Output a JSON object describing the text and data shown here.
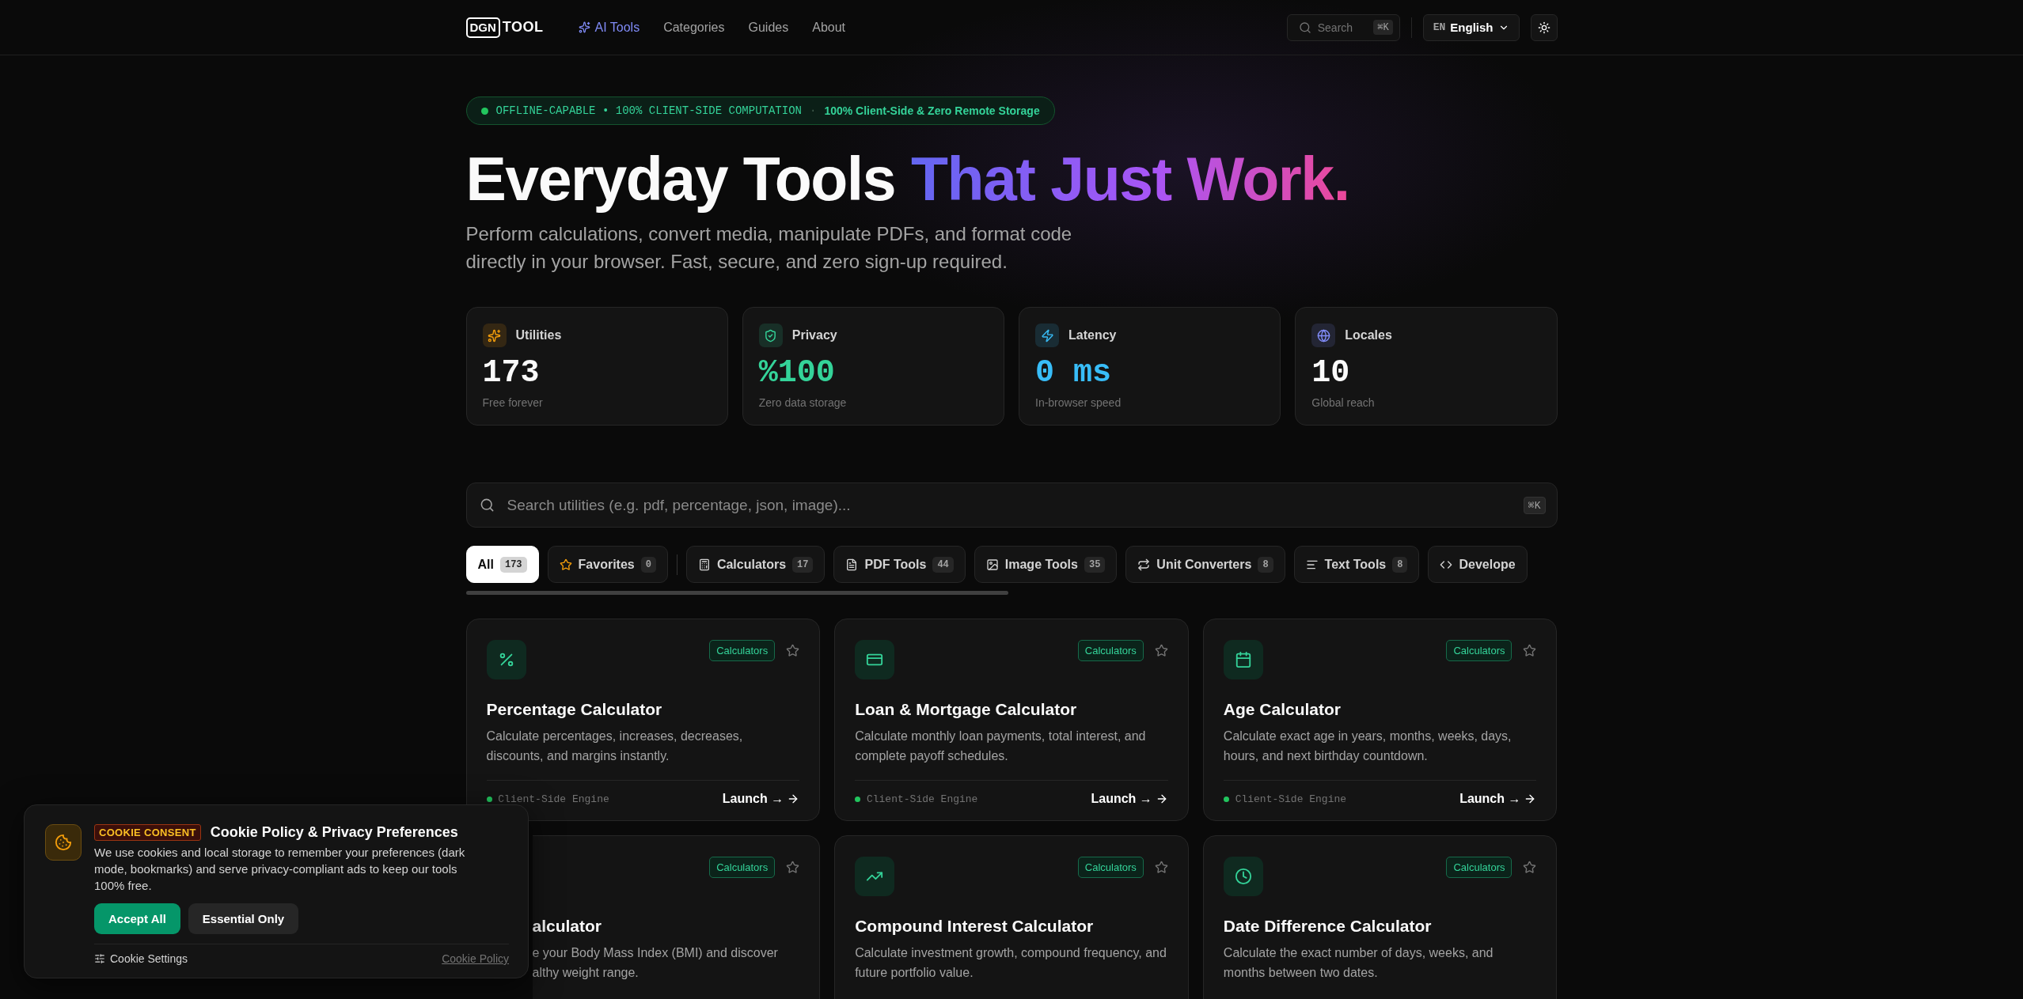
{
  "header": {
    "logo_box": "DGN",
    "logo_text": "TOOL",
    "nav": [
      {
        "label": "AI Tools",
        "selected": true
      },
      {
        "label": "Categories",
        "selected": false
      },
      {
        "label": "Guides",
        "selected": false
      },
      {
        "label": "About",
        "selected": false
      }
    ],
    "search": {
      "placeholder": "Search",
      "shortcut": "⌘K"
    },
    "language": {
      "code": "EN",
      "label": "English"
    }
  },
  "hero": {
    "badge": {
      "left": "OFFLINE-CAPABLE • 100% CLIENT-SIDE COMPUTATION",
      "separator": "·",
      "right": "100% Client-Side & Zero Remote Storage"
    },
    "title_plain": "Everyday Tools",
    "title_gradient": "That Just Work.",
    "subtitle_lines": [
      "Perform calculations, convert media, manipulate PDFs, and format code",
      "directly in your browser. Fast, secure, and zero sign-up required."
    ]
  },
  "stats": [
    {
      "label": "Utilities",
      "value": "173",
      "caption": "Free forever",
      "color": "#f59e0b"
    },
    {
      "label": "Privacy",
      "value": "%100",
      "caption": "Zero data storage",
      "color": "#34d399"
    },
    {
      "label": "Latency",
      "value": "0 ms",
      "caption": "In-browser speed",
      "color": "#38bdf8"
    },
    {
      "label": "Locales",
      "value": "10",
      "caption": "Global reach",
      "color": "#818cf8"
    }
  ],
  "search": {
    "placeholder": "Search utilities (e.g. pdf, percentage, json, image)...",
    "shortcut": "⌘K"
  },
  "tabs": [
    {
      "label": "All",
      "count": "173",
      "selected": true
    },
    {
      "label": "Favorites",
      "count": "0",
      "selected": false
    },
    {
      "label": "Calculators",
      "count": "17",
      "selected": false
    },
    {
      "label": "PDF Tools",
      "count": "44",
      "selected": false
    },
    {
      "label": "Image Tools",
      "count": "35",
      "selected": false
    },
    {
      "label": "Unit Converters",
      "count": "8",
      "selected": false
    },
    {
      "label": "Text Tools",
      "count": "8",
      "selected": false
    },
    {
      "label": "Develope",
      "selected": false
    }
  ],
  "tools": [
    {
      "tag": "Calculators",
      "title": "Percentage Calculator",
      "description": "Calculate percentages, increases, decreases, discounts, and margins instantly.",
      "footer": {
        "engine": "Client-Side Engine",
        "action": "Launch →"
      }
    },
    {
      "tag": "Calculators",
      "title": "Loan & Mortgage Calculator",
      "description": "Calculate monthly loan payments, total interest, and complete payoff schedules.",
      "footer": {
        "engine": "Client-Side Engine",
        "action": "Launch →"
      }
    },
    {
      "tag": "Calculators",
      "title": "Age Calculator",
      "description": "Calculate exact age in years, months, weeks, days, hours, and next birthday countdown.",
      "footer": {
        "engine": "Client-Side Engine",
        "action": "Launch →"
      }
    },
    {
      "tag": "Calculators",
      "title": "alculator",
      "description_lines": [
        "e your Body Mass Index (BMI) and discover",
        "althy weight range."
      ],
      "covered": true
    },
    {
      "tag": "Calculators",
      "title": "Compound Interest Calculator",
      "description": "Calculate investment growth, compound frequency, and future portfolio value."
    },
    {
      "tag": "Calculators",
      "title": "Date Difference Calculator",
      "description": "Calculate the exact number of days, weeks, and months between two dates."
    }
  ],
  "cookie": {
    "badge": "COOKIE CONSENT",
    "title": "Cookie Policy & Privacy Preferences",
    "text_lines": [
      "We use cookies and local storage to remember your preferences (dark",
      "mode, bookmarks) and serve privacy-compliant ads to keep our tools",
      "100% free."
    ],
    "buttons": [
      "Accept All",
      "Essential Only"
    ],
    "settings": "Cookie Settings",
    "policy_link": "Cookie Policy"
  }
}
